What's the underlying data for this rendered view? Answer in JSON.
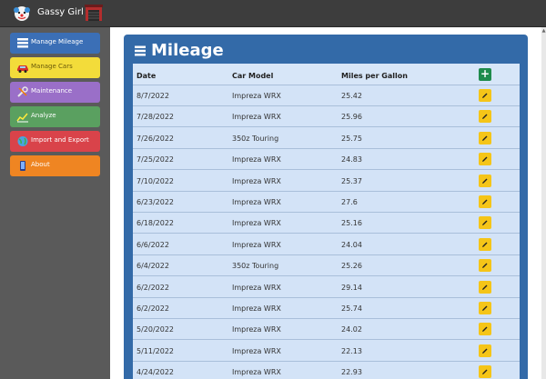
{
  "app": {
    "title": "Gassy Girl",
    "logo_icon": "clown-face-icon",
    "garage_icon": "garage-icon"
  },
  "sidebar": {
    "items": [
      {
        "label": "Manage Mileage",
        "icon": "list-icon",
        "color": "#3b6fb6"
      },
      {
        "label": "Manage Cars",
        "icon": "car-icon",
        "color": "#f3dc3a"
      },
      {
        "label": "Maintenance",
        "icon": "wrench-icon",
        "color": "#9a6fc8"
      },
      {
        "label": "Analyze",
        "icon": "chart-icon",
        "color": "#5aa060"
      },
      {
        "label": "Import and Export",
        "icon": "globe-icon",
        "color": "#d9434a"
      },
      {
        "label": "About",
        "icon": "info-icon",
        "color": "#ef8522"
      }
    ]
  },
  "main": {
    "title": "Mileage",
    "title_icon": "list-icon",
    "columns": [
      "Date",
      "Car Model",
      "Miles per Gallon"
    ],
    "add_icon": "plus-icon",
    "edit_icon": "pencil-icon",
    "rows": [
      {
        "date": "8/7/2022",
        "car": "Impreza WRX",
        "mpg": "25.42"
      },
      {
        "date": "7/28/2022",
        "car": "Impreza WRX",
        "mpg": "25.96"
      },
      {
        "date": "7/26/2022",
        "car": "350z Touring",
        "mpg": "25.75"
      },
      {
        "date": "7/25/2022",
        "car": "Impreza WRX",
        "mpg": "24.83"
      },
      {
        "date": "7/10/2022",
        "car": "Impreza WRX",
        "mpg": "25.37"
      },
      {
        "date": "6/23/2022",
        "car": "Impreza WRX",
        "mpg": "27.6"
      },
      {
        "date": "6/18/2022",
        "car": "Impreza WRX",
        "mpg": "25.16"
      },
      {
        "date": "6/6/2022",
        "car": "Impreza WRX",
        "mpg": "24.04"
      },
      {
        "date": "6/4/2022",
        "car": "350z Touring",
        "mpg": "25.26"
      },
      {
        "date": "6/2/2022",
        "car": "Impreza WRX",
        "mpg": "29.14"
      },
      {
        "date": "6/2/2022",
        "car": "Impreza WRX",
        "mpg": "25.74"
      },
      {
        "date": "5/20/2022",
        "car": "Impreza WRX",
        "mpg": "24.02"
      },
      {
        "date": "5/11/2022",
        "car": "Impreza WRX",
        "mpg": "22.13"
      },
      {
        "date": "4/24/2022",
        "car": "Impreza WRX",
        "mpg": "22.93"
      }
    ]
  }
}
